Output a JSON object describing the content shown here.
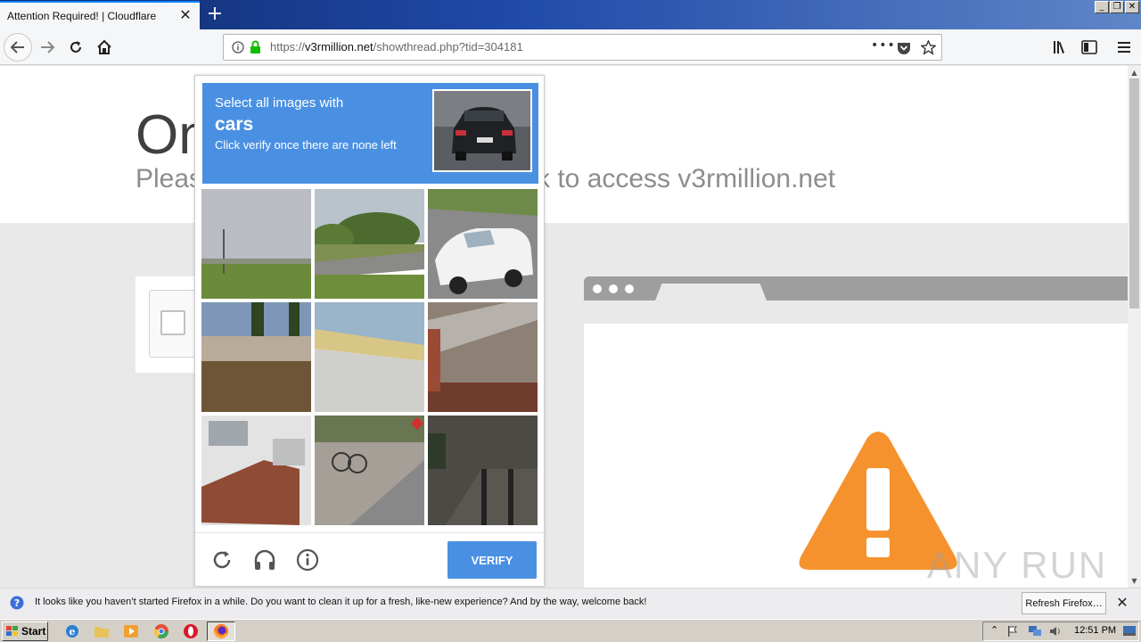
{
  "browser": {
    "tab_title": "Attention Required! | Cloudflare",
    "url_prefix": "https://",
    "url_host": "v3rmillion.net",
    "url_path": "/showthread.php?tid=304181"
  },
  "page": {
    "heading": "One",
    "subheading_left": "Pleas",
    "subheading_right": "k to access v3rmillion.net",
    "watermark": "ANY RUN"
  },
  "captcha": {
    "instruction": "Select all images with",
    "target": "cars",
    "hint": "Click verify once there are none left",
    "verify_label": "VERIFY",
    "tiles": [
      "grass-field-pole",
      "trees-and-road",
      "white-car",
      "stone-wall-trees",
      "bridge-overpass",
      "roof-tiles",
      "house-stairs",
      "sidewalk-bicycles",
      "dark-stairs"
    ]
  },
  "notification": {
    "message": "It looks like you haven’t started Firefox in a while. Do you want to clean it up for a fresh, like-new experience? And by the way, welcome back!",
    "button_label": "Refresh Firefox…"
  },
  "taskbar": {
    "start_label": "Start",
    "clock": "12:51 PM"
  },
  "colors": {
    "captcha_blue": "#4a90e2",
    "warning_orange": "#f6922e"
  }
}
